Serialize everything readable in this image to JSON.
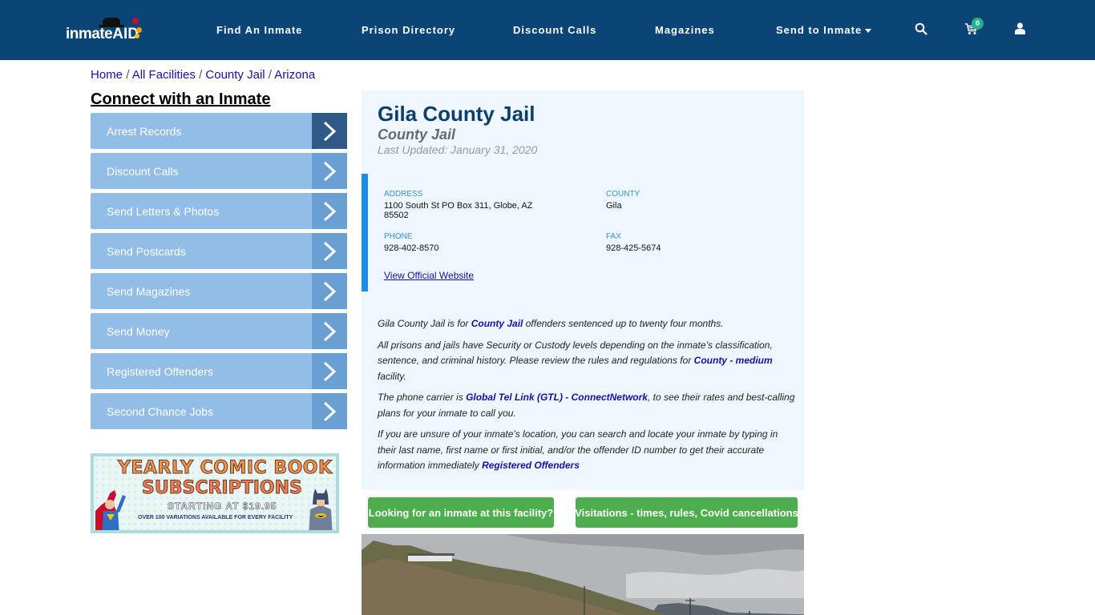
{
  "header": {
    "logo": {
      "text": "inmate",
      "accent": "AID"
    },
    "nav": [
      {
        "label": "Find An Inmate"
      },
      {
        "label": "Prison Directory"
      },
      {
        "label": "Discount Calls"
      },
      {
        "label": "Magazines"
      },
      {
        "label": "Send to Inmate",
        "has_dropdown": true
      }
    ],
    "cart_count": "0",
    "icons": [
      "search-icon",
      "cart-icon",
      "user-icon"
    ],
    "colors": {
      "navbar_bg": "#0b4477",
      "badge": "#27ae8c"
    }
  },
  "breadcrumb": {
    "items": [
      "Home",
      "All Facilities",
      "County Jail",
      "Arizona"
    ],
    "separator": "/"
  },
  "sidebar": {
    "title": "Connect with an Inmate",
    "items": [
      {
        "label": "Arrest Records",
        "active": true
      },
      {
        "label": "Discount Calls"
      },
      {
        "label": "Send Letters & Photos"
      },
      {
        "label": "Send Postcards"
      },
      {
        "label": "Send Magazines"
      },
      {
        "label": "Send Money"
      },
      {
        "label": "Registered Offenders"
      },
      {
        "label": "Second Chance Jobs"
      }
    ],
    "ad": {
      "line1": "YEARLY COMIC BOOK",
      "line2": "SUBSCRIPTIONS",
      "line3": "STARTING AT $19.95",
      "line4": "OVER 100 VARIATIONS AVAILABLE FOR EVERY FACILITY"
    }
  },
  "facility": {
    "name": "Gila County Jail",
    "type": "County Jail",
    "last_updated": "Last Updated: January 31, 2020",
    "address_label": "ADDRESS",
    "address_line1": "1100 South St PO Box 311, Globe, AZ",
    "address_line2": "85502",
    "county_label": "COUNTY",
    "county": "Gila",
    "phone_label": "PHONE",
    "phone": "928-402-8570",
    "fax_label": "FAX",
    "fax": "928-425-5674",
    "website_link": "View Official Website"
  },
  "description": {
    "p1": {
      "before": "Gila County Jail is for ",
      "link": "County Jail",
      "after": " offenders sentenced up to twenty four months."
    },
    "p2": {
      "before": "All prisons and jails have Security or Custody levels depending on the inmate’s classification, sentence, and criminal history. Please review the rules and regulations for ",
      "link": "County - medium",
      "after": " facility."
    },
    "p3": {
      "before": "The phone carrier is ",
      "link": "Global Tel Link (GTL) - ConnectNetwork",
      "after": ", to see their rates and best-calling plans for your inmate to call you."
    },
    "p4": {
      "before": "If you are unsure of your inmate's location, you can search and locate your inmate by typing in their last name, first name or first initial, and/or the offender ID number to get their accurate information immediately ",
      "link": "Registered Offenders",
      "after": ""
    }
  },
  "buttons": {
    "find_inmate": "Looking for an inmate at this facility?",
    "visitation": "Visitations - times, rules, Covid cancellations"
  },
  "photo": {
    "alt": "Gila County Jail exterior photo"
  }
}
